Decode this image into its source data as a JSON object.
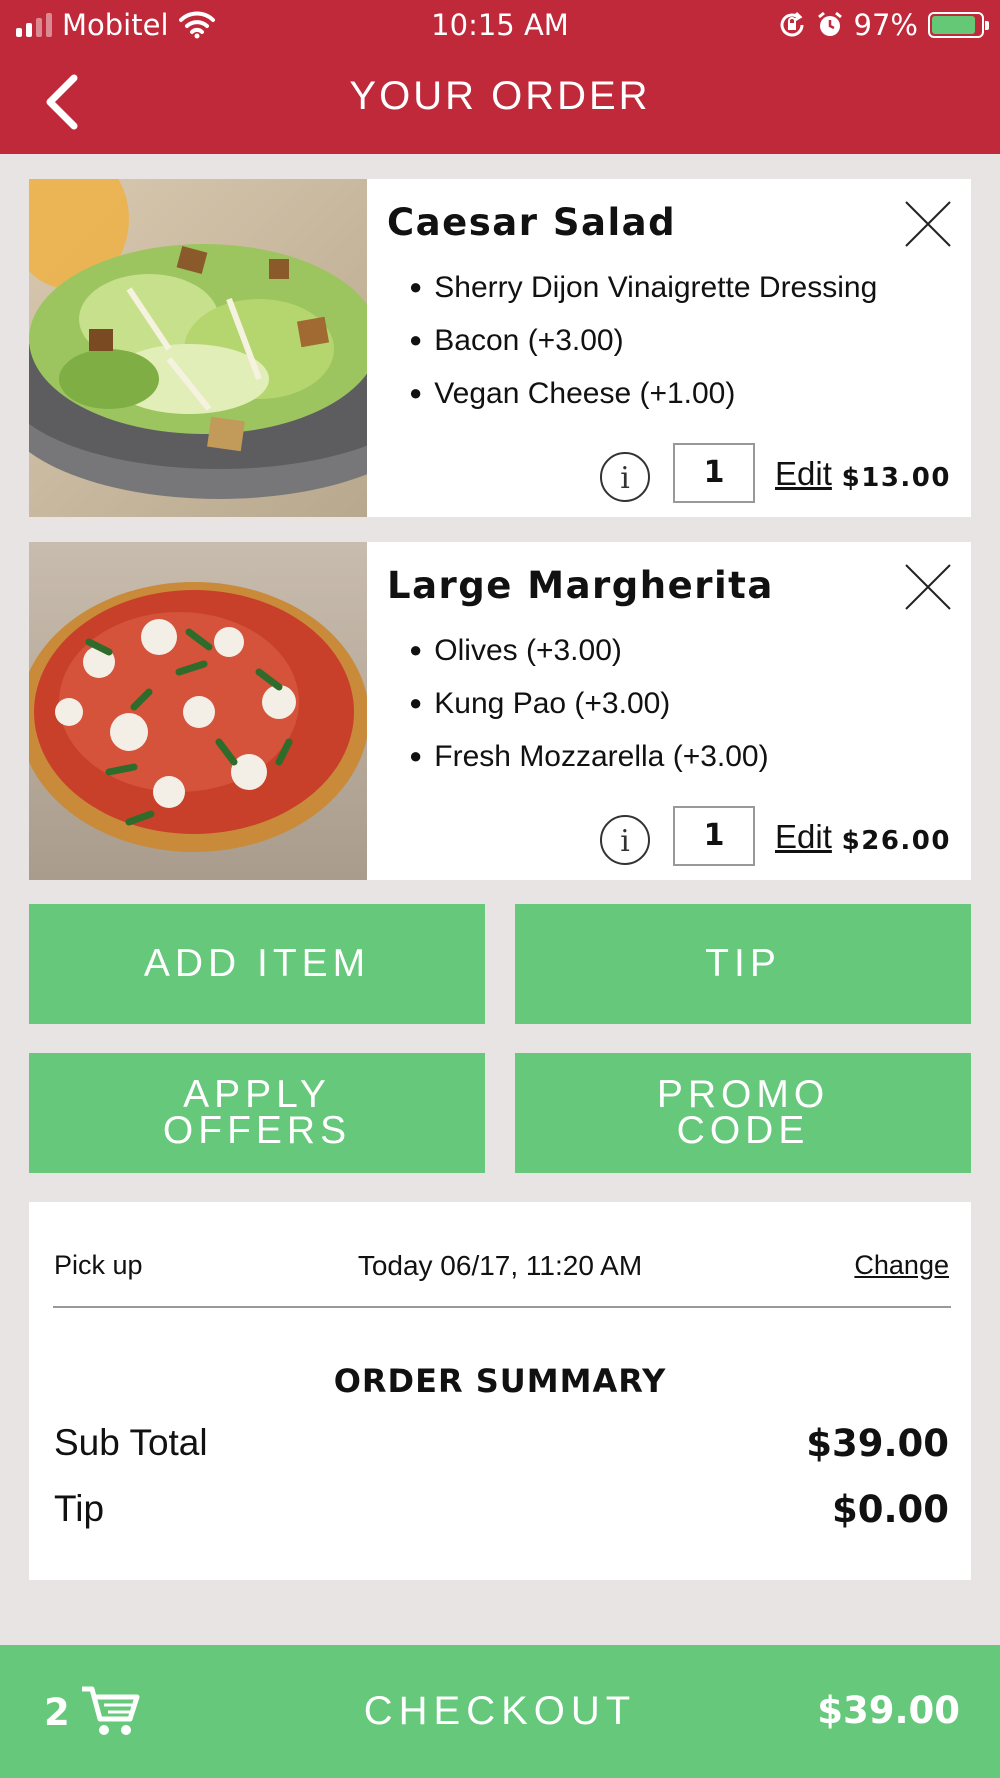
{
  "status_bar": {
    "carrier": "Mobitel",
    "time": "10:15 AM",
    "battery": "97%"
  },
  "header": {
    "title": "YOUR ORDER"
  },
  "items": [
    {
      "name": "Caesar Salad",
      "options": [
        "Sherry Dijon Vinaigrette Dressing",
        "Bacon (+3.00)",
        "Vegan Cheese (+1.00)"
      ],
      "quantity": "1",
      "edit_label": "Edit",
      "price": "$13.00"
    },
    {
      "name": "Large Margherita",
      "options": [
        "Olives (+3.00)",
        "Kung Pao (+3.00)",
        "Fresh Mozzarella (+3.00)"
      ],
      "quantity": "1",
      "edit_label": "Edit",
      "price": "$26.00"
    }
  ],
  "actions": {
    "add_item": "ADD ITEM",
    "tip": "TIP",
    "apply_offers_line1": "APPLY",
    "apply_offers_line2": "OFFERS",
    "promo_code_line1": "PROMO",
    "promo_code_line2": "CODE"
  },
  "pickup": {
    "label": "Pick up",
    "time": "Today 06/17, 11:20 AM",
    "change_label": "Change"
  },
  "summary": {
    "title": "ORDER SUMMARY",
    "subtotal_label": "Sub Total",
    "subtotal_value": "$39.00",
    "tip_label": "Tip",
    "tip_value": "$0.00"
  },
  "checkout": {
    "cart_count": "2",
    "label": "CHECKOUT",
    "total": "$39.00"
  },
  "colors": {
    "header_red": "#c0293a",
    "button_green": "#65c87a",
    "background": "#e8e4e3"
  }
}
